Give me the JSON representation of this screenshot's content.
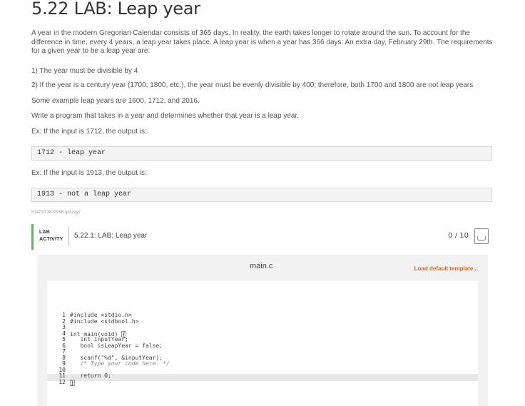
{
  "page": {
    "title": "5.22 LAB: Leap year",
    "paragraphs": [
      "A year in the modern Gregorian Calendar consists of 365 days. In reality, the earth takes longer to rotate around the sun. To account for the difference in time, every 4 years, a leap year takes place. A leap year is when a year has 366 days: An extra day, February 29th. The requirements for a given year to be a leap year are:",
      "1) The year must be divisible by 4",
      "2) If the year is a century year (1700, 1800, etc.), the year must be evenly divisible by 400; therefore, both 1700 and 1800 are not leap years",
      "Some example leap years are 1600, 1712, and 2016.",
      "Write a program that takes in a year and determines whether that year is a leap year.",
      "Ex: If the input is 1712, the output is:",
      "Ex: If the input is 1913, the output is:"
    ],
    "example_outputs": [
      "1712 - leap year",
      "1913 - not a leap year"
    ],
    "meta_id": "514710.3672958.qx3zqy7"
  },
  "lab": {
    "badge_line1": "LAB",
    "badge_line2": "ACTIVITY",
    "title": "5.22.1: LAB: Leap year",
    "score": "0 / 10",
    "accent_color": "#5cb85c"
  },
  "editor": {
    "file_name": "main.c",
    "load_template_label": "Load default template...",
    "line_numbers": [
      "1",
      "2",
      "3",
      "4",
      "5",
      "6",
      "7",
      "8",
      "9",
      "10",
      "11",
      "12"
    ],
    "code": [
      "#include <stdio.h>",
      "#include <stdbool.h>",
      "",
      "int main(void) ",
      "   int inputYear;",
      "   bool isLeapYear = false;",
      "",
      "   scanf(\"%d\", &inputYear);",
      "   /* Type your code here. */",
      "",
      "   return 0;",
      ""
    ],
    "open_brace": "{",
    "close_brace": "}",
    "load_color": "#e0661b"
  }
}
